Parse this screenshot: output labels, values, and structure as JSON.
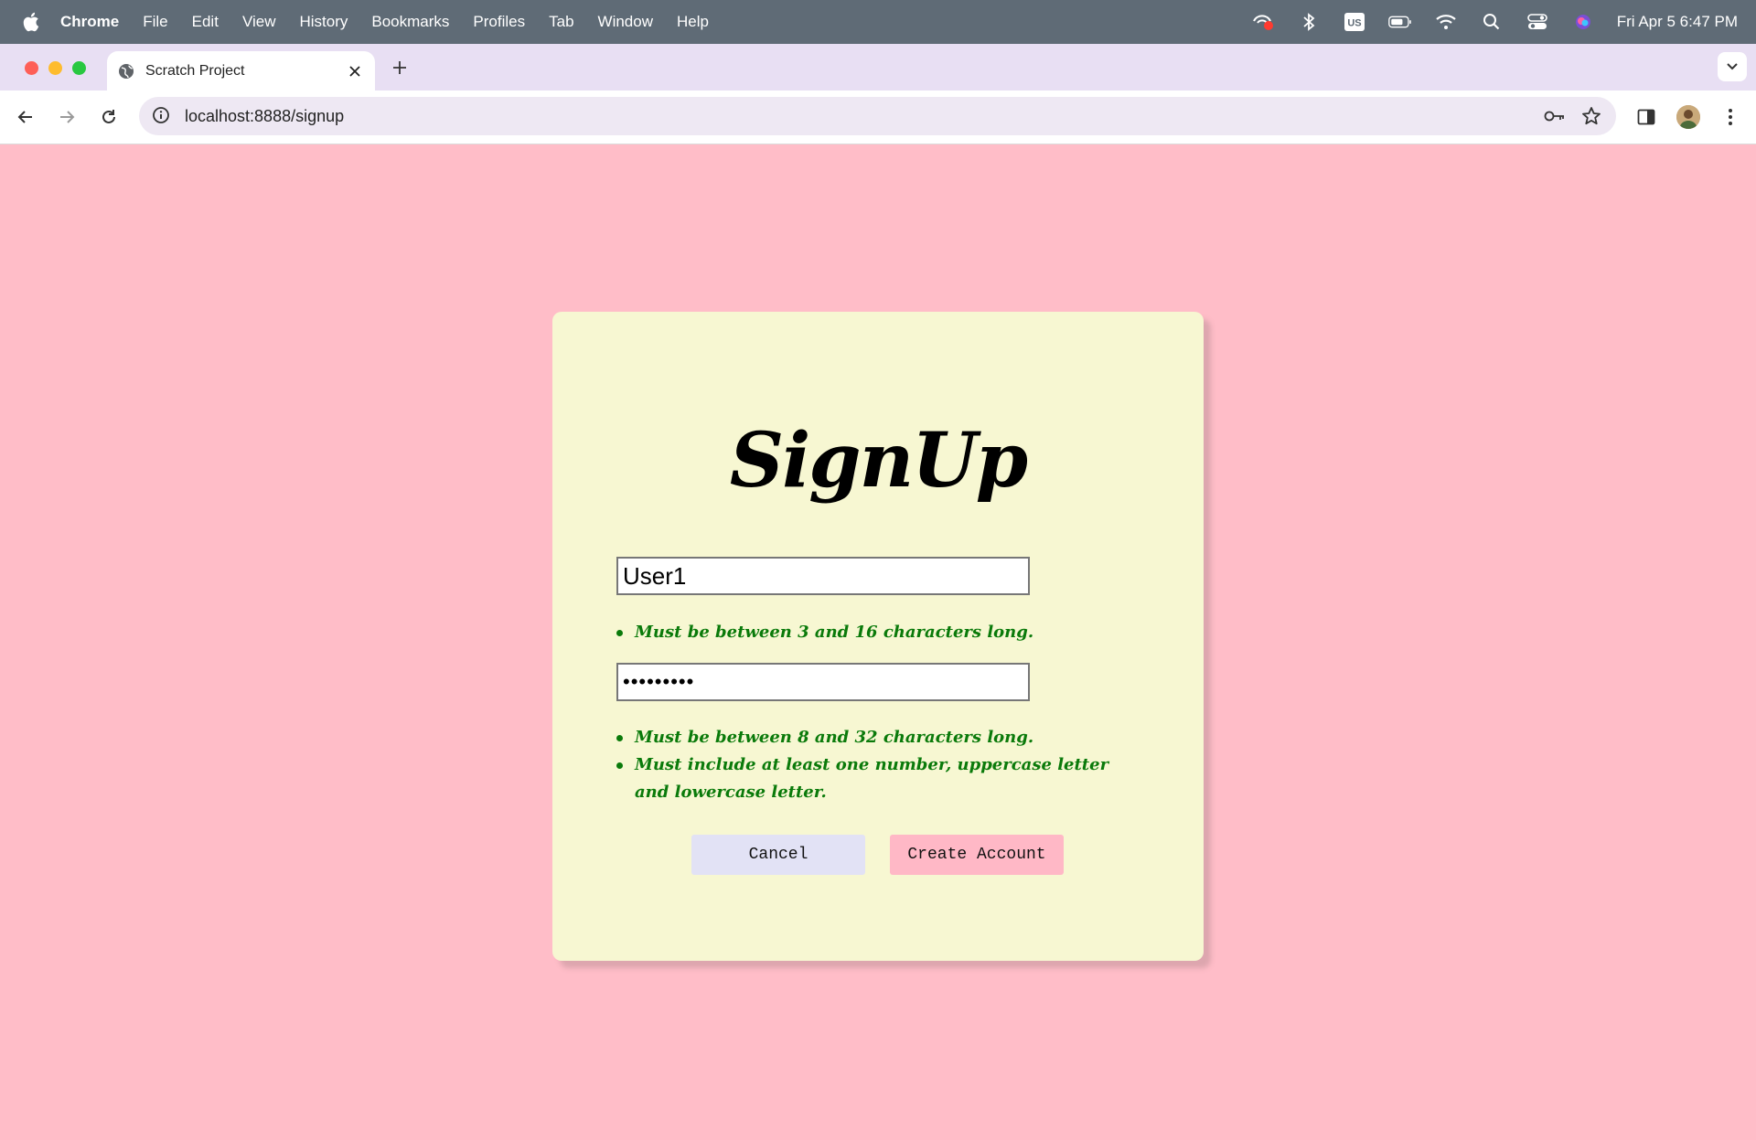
{
  "menubar": {
    "app_name": "Chrome",
    "items": [
      "File",
      "Edit",
      "View",
      "History",
      "Bookmarks",
      "Profiles",
      "Tab",
      "Window",
      "Help"
    ],
    "keyboard_badge": "US",
    "clock": "Fri Apr 5  6:47 PM"
  },
  "browser": {
    "tab_title": "Scratch Project",
    "url": "localhost:8888/signup"
  },
  "signup": {
    "title": "SignUp",
    "username_value": "User1",
    "password_value": "•••••••••",
    "username_rules": [
      "Must be between 3 and 16 characters long."
    ],
    "password_rules": [
      "Must be between 8 and 32 characters long.",
      "Must include at least one number, uppercase letter and lowercase letter."
    ],
    "cancel_label": "Cancel",
    "create_label": "Create Account"
  },
  "colors": {
    "page_background": "#ffbdc8",
    "card_background": "#f7f7d2",
    "rule_text": "#0a7a0a",
    "cancel_button": "#e2e2f5",
    "create_button": "#ffb8c6"
  }
}
